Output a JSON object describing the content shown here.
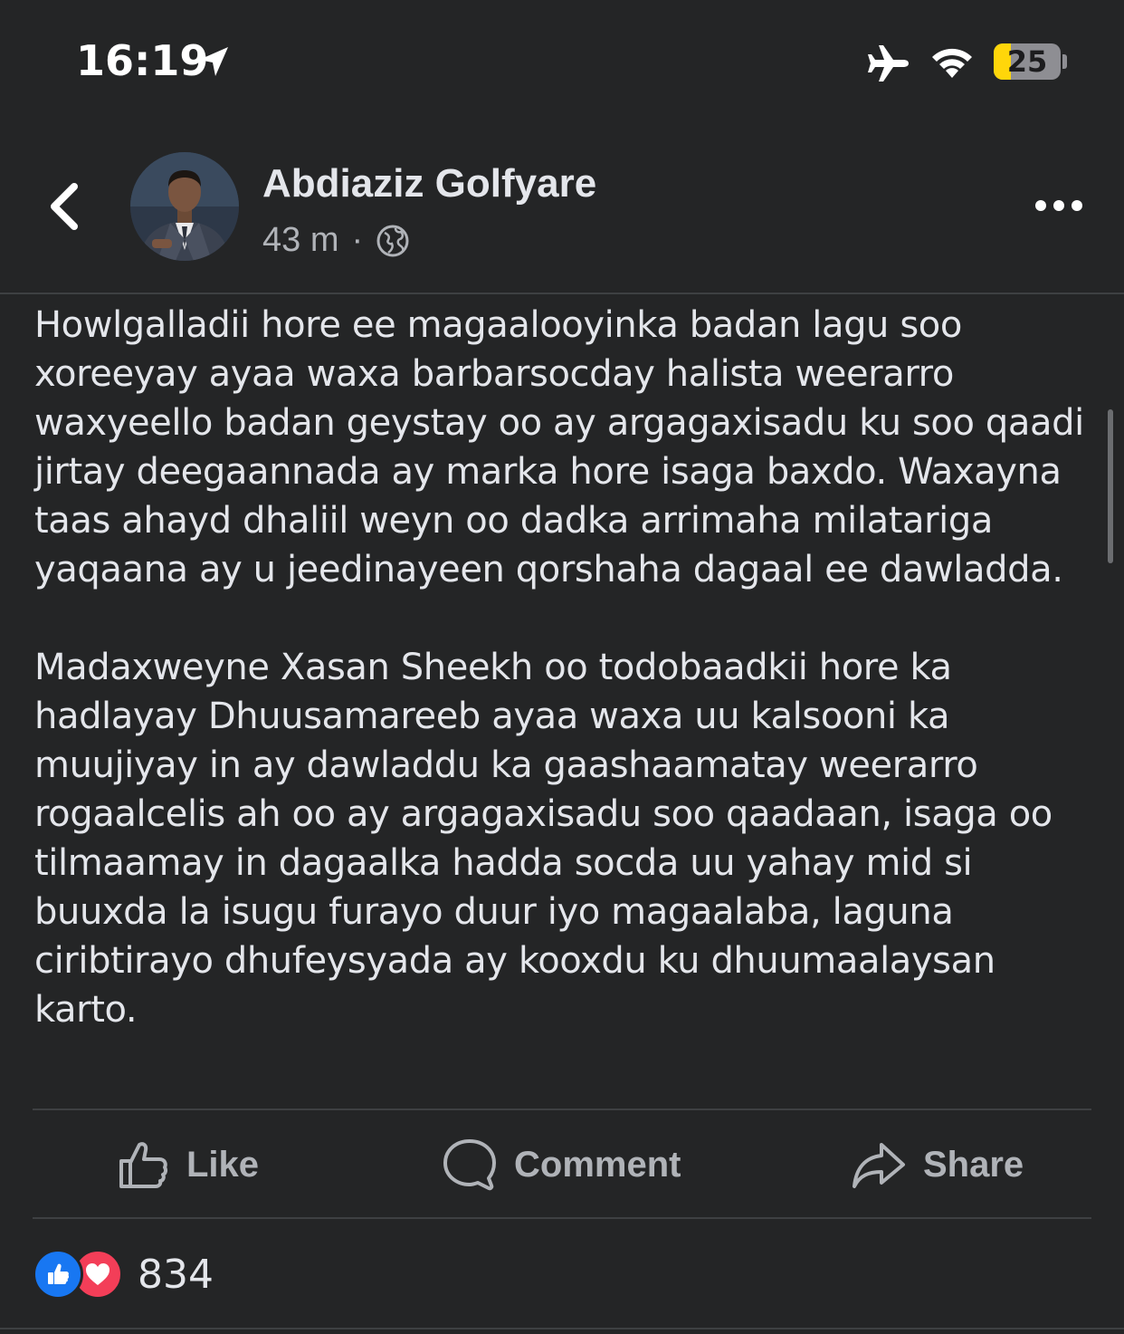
{
  "status_bar": {
    "time": "16:19",
    "battery_level": "25"
  },
  "post": {
    "author": "Abdiaziz Golfyare",
    "time_ago": "43 m",
    "separator": "·",
    "paragraphs": [
      "Howlgalladii hore ee magaalooyinka badan lagu soo xoreeyay ayaa waxa barbarsocday halista weerarro waxyeello badan geystay oo ay argagaxisadu ku soo qaadi jirtay deegaannada ay marka hore isaga baxdo. Waxayna taas ahayd dhaliil weyn oo dadka arrimaha milatariga yaqaana ay u jeedinayeen qorshaha dagaal ee dawladda.",
      "Madaxweyne Xasan Sheekh oo todobaadkii hore ka hadlayay Dhuusamareeb ayaa waxa uu kalsooni ka muujiyay in ay dawladdu ka gaashaamatay weerarro rogaalcelis ah oo ay argagaxisadu soo qaadaan, isaga oo tilmaamay in dagaalka hadda socda uu yahay mid si buuxda la isugu furayo duur iyo magaalaba, laguna ciribtirayo dhufeysyada ay kooxdu ku dhuumaalaysan karto."
    ]
  },
  "actions": {
    "like_label": "Like",
    "comment_label": "Comment",
    "share_label": "Share"
  },
  "reactions": {
    "count": "834",
    "types": [
      "like",
      "love"
    ]
  },
  "icons": {
    "location": "location-arrow-icon",
    "airplane": "airplane-mode-icon",
    "wifi": "wifi-icon",
    "battery": "battery-icon",
    "back": "chevron-left-icon",
    "globe": "globe-icon",
    "more": "more-options-icon",
    "like": "thumbs-up-icon",
    "comment": "comment-bubble-icon",
    "share": "share-arrow-icon"
  },
  "colors": {
    "background": "#242526",
    "text_primary": "#e4e6eb",
    "text_secondary": "#b0b3b8",
    "like_blue": "#1877f2",
    "love_red": "#f33e58",
    "battery_yellow": "#ffd60a"
  }
}
